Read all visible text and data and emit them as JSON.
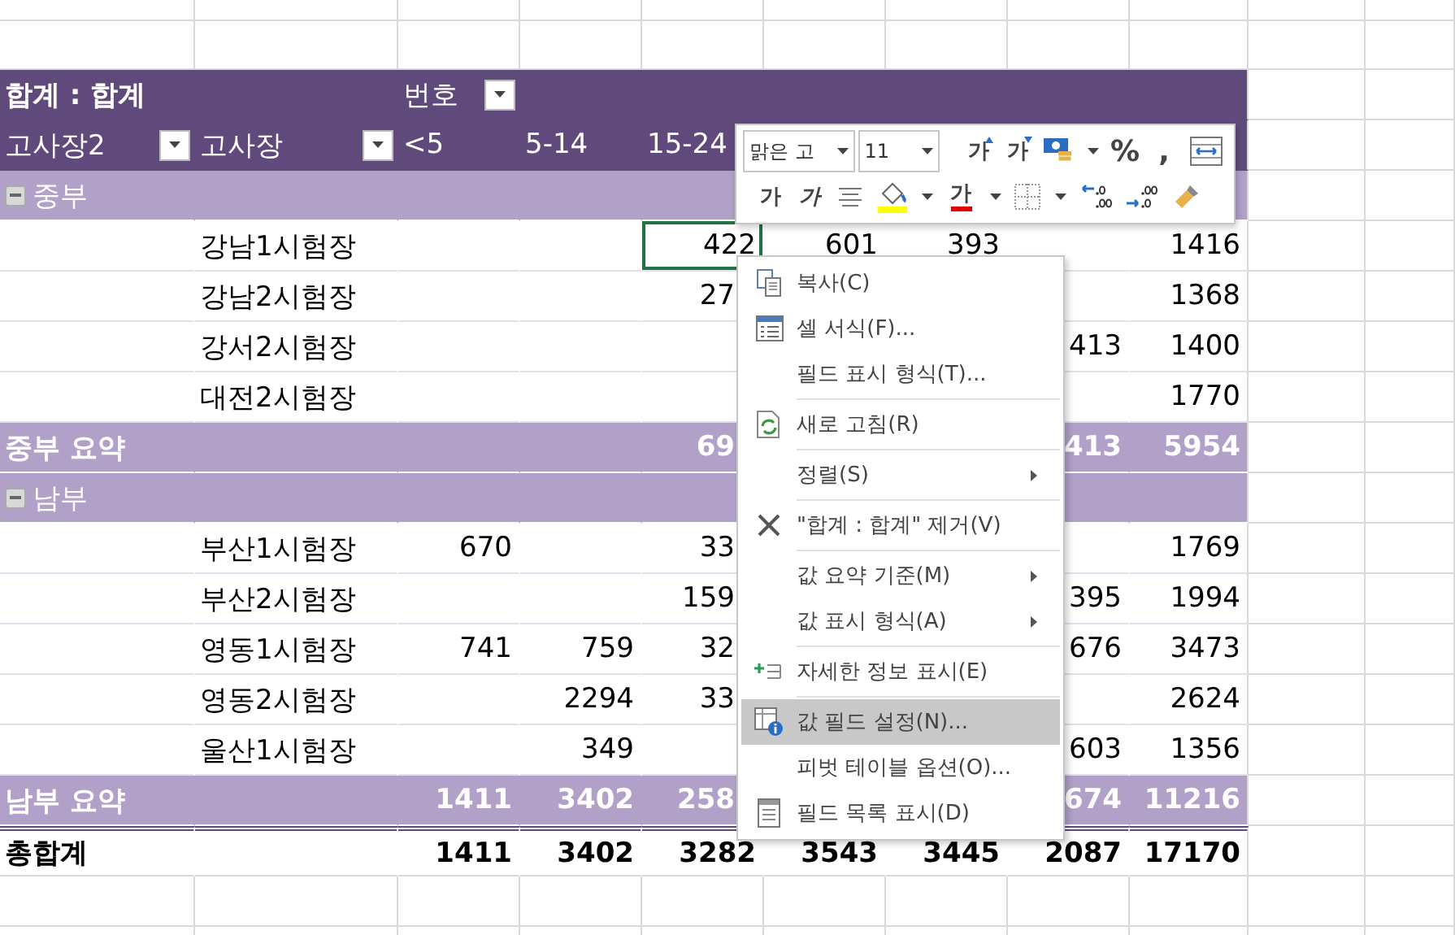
{
  "pivot": {
    "title": "합계 : 합계",
    "column_field": {
      "label": "번호"
    },
    "row_fields": [
      {
        "label": "고사장2"
      },
      {
        "label": "고사장"
      }
    ],
    "column_labels": [
      "<5",
      "5-14",
      "15-24"
    ],
    "rows": [
      {
        "kind": "group",
        "label": "중부",
        "expanded": true
      },
      {
        "kind": "item",
        "label": "강남1시험장",
        "cells": [
          null,
          null,
          {
            "text": "422",
            "selected": true
          },
          {
            "text": "601",
            "selected": false
          },
          {
            "text": "393",
            "selected": false
          },
          null,
          {
            "text": "1416",
            "selected": false
          }
        ]
      },
      {
        "kind": "item",
        "label": "강남2시험장",
        "cells": [
          null,
          null,
          {
            "text": "27",
            "selected": false,
            "cut": true
          },
          null,
          null,
          null,
          {
            "text": "1368",
            "selected": false
          }
        ]
      },
      {
        "kind": "item",
        "label": "강서2시험장",
        "cells": [
          null,
          null,
          null,
          null,
          null,
          {
            "text": "413",
            "selected": false
          },
          {
            "text": "1400",
            "selected": false
          }
        ]
      },
      {
        "kind": "item",
        "label": "대전2시험장",
        "cells": [
          null,
          null,
          null,
          null,
          null,
          null,
          {
            "text": "1770",
            "selected": false
          }
        ]
      },
      {
        "kind": "subtotal",
        "label": "중부 요약",
        "cells": [
          null,
          null,
          {
            "text": "69",
            "selected": false,
            "cut": true
          },
          null,
          null,
          {
            "text": "413",
            "selected": false
          },
          {
            "text": "5954",
            "selected": false
          }
        ]
      },
      {
        "kind": "group",
        "label": "남부",
        "expanded": true
      },
      {
        "kind": "item",
        "label": "부산1시험장",
        "cells": [
          {
            "text": "670",
            "selected": false
          },
          null,
          {
            "text": "33",
            "selected": false,
            "cut": true
          },
          null,
          null,
          null,
          {
            "text": "1769",
            "selected": false
          }
        ]
      },
      {
        "kind": "item",
        "label": "부산2시험장",
        "cells": [
          null,
          null,
          {
            "text": "159",
            "selected": false,
            "cut": true
          },
          null,
          null,
          {
            "text": "395",
            "selected": false
          },
          {
            "text": "1994",
            "selected": false
          }
        ]
      },
      {
        "kind": "item",
        "label": "영동1시험장",
        "cells": [
          {
            "text": "741",
            "selected": false
          },
          {
            "text": "759",
            "selected": false
          },
          {
            "text": "32",
            "selected": false,
            "cut": true
          },
          null,
          null,
          {
            "text": "676",
            "selected": false
          },
          {
            "text": "3473",
            "selected": false
          }
        ]
      },
      {
        "kind": "item",
        "label": "영동2시험장",
        "cells": [
          null,
          {
            "text": "2294",
            "selected": false
          },
          {
            "text": "33",
            "selected": false,
            "cut": true
          },
          null,
          null,
          null,
          {
            "text": "2624",
            "selected": false
          }
        ]
      },
      {
        "kind": "item",
        "label": "울산1시험장",
        "cells": [
          null,
          {
            "text": "349",
            "selected": false
          },
          null,
          null,
          null,
          {
            "text": "603",
            "selected": false
          },
          {
            "text": "1356",
            "selected": false
          }
        ]
      },
      {
        "kind": "subtotal",
        "label": "남부 요약",
        "cells": [
          {
            "text": "1411",
            "selected": false
          },
          {
            "text": "3402",
            "selected": false
          },
          {
            "text": "258",
            "selected": false,
            "cut": true
          },
          null,
          null,
          {
            "text": "674",
            "selected": false
          },
          {
            "text": "11216",
            "selected": false
          }
        ]
      },
      {
        "kind": "total",
        "label": "총합계",
        "cells": [
          {
            "text": "1411",
            "selected": false
          },
          {
            "text": "3402",
            "selected": false
          },
          {
            "text": "3282",
            "selected": false
          },
          {
            "text": "3543",
            "selected": false
          },
          {
            "text": "3445",
            "selected": false
          },
          {
            "text": "2087",
            "selected": false
          },
          {
            "text": "17170",
            "selected": false
          }
        ]
      }
    ]
  },
  "mini_toolbar": {
    "font": "맑은 고",
    "size": "11",
    "row_1": [
      {
        "kind": "grow",
        "text": "가"
      },
      {
        "kind": "shrink",
        "text": "가"
      },
      {
        "kind": "accounting"
      },
      {
        "kind": "caret"
      },
      {
        "kind": "char",
        "text": "%"
      },
      {
        "kind": "char",
        "text": ","
      },
      {
        "kind": "wrap"
      }
    ],
    "row_2": [
      {
        "kind": "bold",
        "text": "가"
      },
      {
        "kind": "italic",
        "text": "가"
      },
      {
        "kind": "align"
      },
      {
        "kind": "fill"
      },
      {
        "kind": "caret"
      },
      {
        "kind": "font_color",
        "text": "가"
      },
      {
        "kind": "caret"
      },
      {
        "kind": "borders"
      },
      {
        "kind": "caret"
      },
      {
        "kind": "increase_decimal"
      },
      {
        "kind": "decrease_decimal"
      },
      {
        "kind": "painter"
      }
    ]
  },
  "context_menu": {
    "items": [
      {
        "kind": "copy",
        "label": "복사(C)",
        "selected": false
      },
      {
        "kind": "format",
        "label": "셀 서식(F)...",
        "selected": false
      },
      {
        "kind": "plain",
        "label": "필드 표시 형식(T)...",
        "selected": false
      },
      {
        "kind": "separator"
      },
      {
        "kind": "refresh",
        "label": "새로 고침(R)",
        "selected": false
      },
      {
        "kind": "separator"
      },
      {
        "kind": "submenu",
        "label": "정렬(S)",
        "selected": false
      },
      {
        "kind": "separator"
      },
      {
        "kind": "remove",
        "label": "\"합계 : 합계\" 제거(V)",
        "selected": false
      },
      {
        "kind": "separator"
      },
      {
        "kind": "submenu",
        "label": "값 요약 기준(M)",
        "selected": false
      },
      {
        "kind": "submenu",
        "label": "값 표시 형식(A)",
        "selected": false
      },
      {
        "kind": "separator"
      },
      {
        "kind": "details",
        "label": "자세한 정보 표시(E)",
        "selected": false
      },
      {
        "kind": "separator"
      },
      {
        "kind": "field_settings",
        "label": "값 필드 설정(N)...",
        "selected": true
      },
      {
        "kind": "plain",
        "label": "피벗 테이블 옵션(O)...",
        "selected": false
      },
      {
        "kind": "field_list",
        "label": "필드 목록 표시(D)",
        "selected": false
      }
    ]
  }
}
